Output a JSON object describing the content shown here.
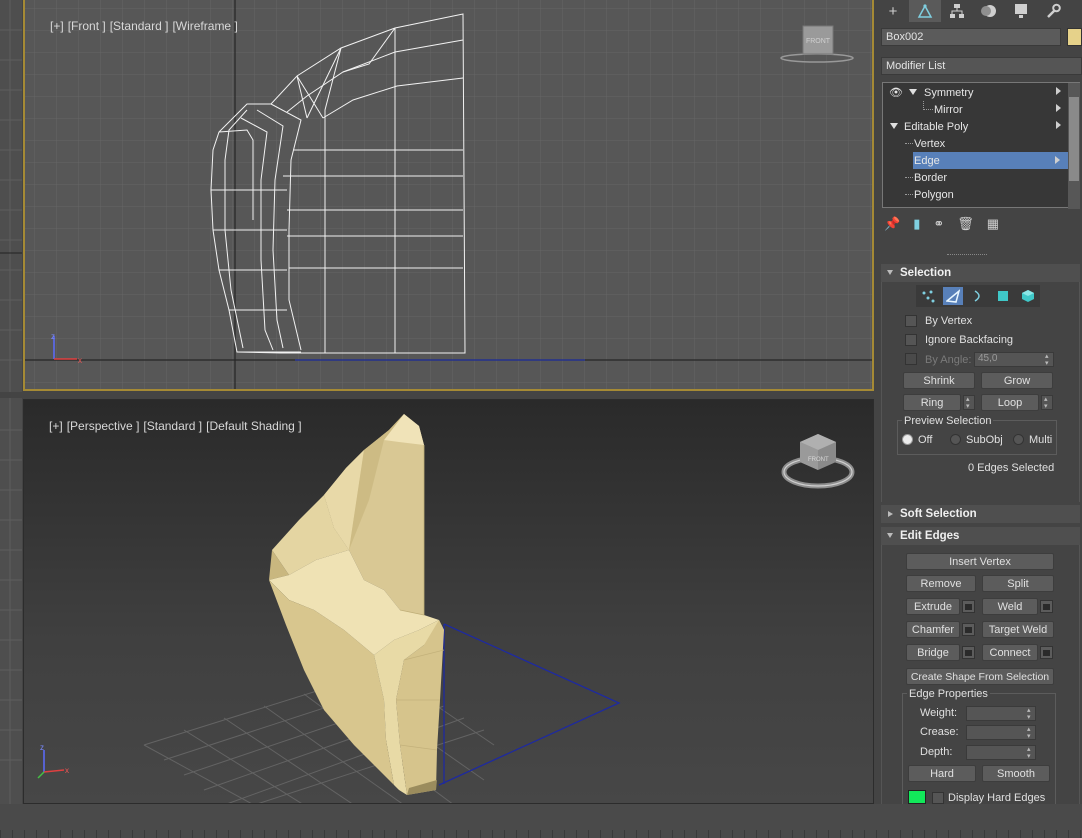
{
  "viewports": {
    "front": {
      "label_parts": [
        "[+]",
        "[Front ]",
        "[Standard ]",
        "[Wireframe ]"
      ],
      "viewcube_face": "FRONT"
    },
    "perspective": {
      "label_parts": [
        "[+]",
        "[Perspective ]",
        "[Standard ]",
        "[Default Shading ]"
      ],
      "viewcube_face": "FRONT"
    }
  },
  "command_panel": {
    "tab_icons": [
      "create-icon",
      "modify-icon",
      "hierarchy-icon",
      "motion-icon",
      "display-icon",
      "utilities-icon"
    ],
    "object_name": "Box002",
    "object_color": "#e6d28a",
    "modifier_list": "Modifier List",
    "stack": {
      "symmetry": "Symmetry",
      "mirror": "Mirror",
      "editable_poly": "Editable Poly",
      "vertex": "Vertex",
      "edge": "Edge",
      "border": "Border",
      "polygon": "Polygon"
    },
    "selection": {
      "title": "Selection",
      "by_vertex": "By Vertex",
      "ignore_backfacing": "Ignore Backfacing",
      "by_angle": "By Angle:",
      "by_angle_value": "45,0",
      "shrink": "Shrink",
      "grow": "Grow",
      "ring": "Ring",
      "loop": "Loop",
      "preview_selection": "Preview Selection",
      "off": "Off",
      "subobj": "SubObj",
      "multi": "Multi",
      "status": "0 Edges Selected"
    },
    "soft_selection": {
      "title": "Soft Selection"
    },
    "edit_edges": {
      "title": "Edit Edges",
      "insert_vertex": "Insert Vertex",
      "remove": "Remove",
      "split": "Split",
      "extrude": "Extrude",
      "weld": "Weld",
      "chamfer": "Chamfer",
      "target_weld": "Target Weld",
      "bridge": "Bridge",
      "connect": "Connect",
      "create_shape": "Create Shape From Selection",
      "edge_properties": "Edge Properties",
      "weight": "Weight:",
      "crease": "Crease:",
      "depth": "Depth:",
      "hard": "Hard",
      "smooth": "Smooth",
      "display_hard_edges": "Display Hard Edges",
      "hard_edge_color": "#12e85a"
    }
  }
}
